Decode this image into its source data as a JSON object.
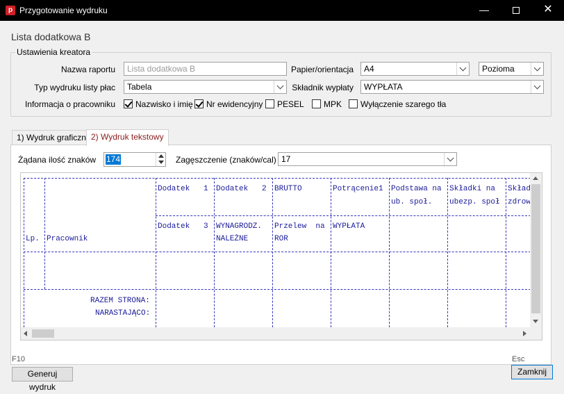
{
  "window": {
    "title": "Przygotowanie wydruku",
    "minimize": "—",
    "close": "✕"
  },
  "page": {
    "title": "Lista dodatkowa B"
  },
  "settings": {
    "legend": "Ustawienia kreatora",
    "report_name_label": "Nazwa raportu",
    "report_name_value": "Lista dodatkowa B",
    "payslip_type_label": "Typ wydruku listy płac",
    "payslip_type_value": "Tabela",
    "paper_label": "Papier/orientacja",
    "paper_value": "A4",
    "orientation_value": "Pozioma",
    "component_label": "Składnik wypłaty",
    "component_value": "WYPŁATA",
    "employee_info_label": "Informacja o pracowniku",
    "checkboxes": [
      {
        "label": "Nazwisko i imię",
        "checked": true
      },
      {
        "label": "Nr ewidencyjny",
        "checked": true
      },
      {
        "label": "PESEL",
        "checked": false
      },
      {
        "label": "MPK",
        "checked": false
      },
      {
        "label": "Wyłączenie szarego tła",
        "checked": false
      }
    ]
  },
  "tabs": [
    {
      "label": "1) Wydruk graficzny",
      "active": false
    },
    {
      "label": "2) Wydruk tekstowy",
      "active": true
    }
  ],
  "text_print": {
    "chars_label": "Żądana ilość znaków",
    "chars_value": "174",
    "density_label": "Zagęszczenie (znaków/cal)",
    "density_value": "17"
  },
  "preview": {
    "columns": {
      "lp": "Lp.",
      "pracownik": "Pracownik",
      "c1a": "Dodatek   1",
      "c2a": "Dodatek   2",
      "c3a": "BRUTTO",
      "c4a": "Potrącenie1",
      "c5a": "Podstawa na",
      "c5b": "ub. społ.",
      "c6a": "Składki na",
      "c6b": "ubezp. społ",
      "c7a": "Skład",
      "c7b": "zdrow",
      "c1c": "Dodatek   3",
      "c2c": "WYNAGRODZ.",
      "c2d": "NALEŻNE",
      "c3c": "Przelew  na",
      "c3d": "ROR",
      "c4c": "WYPŁATA"
    },
    "totals": {
      "page_total": "RAZEM STRONA:",
      "cumulative": "NARASTAJĄCO:"
    }
  },
  "footer": {
    "generate_shortcut": "F10",
    "generate_label": "Generuj wydruk",
    "close_shortcut": "Esc",
    "close_label": "Zamknij"
  }
}
